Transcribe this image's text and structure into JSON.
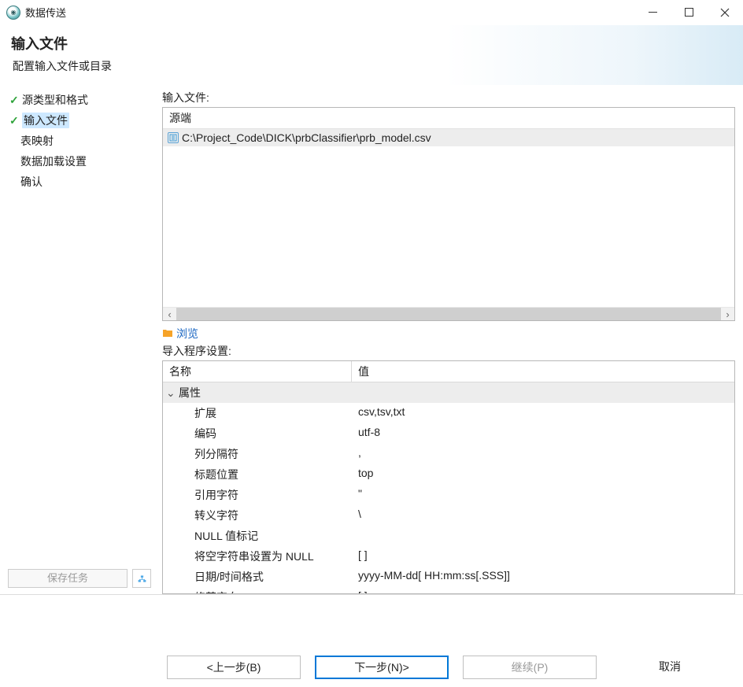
{
  "window": {
    "title": "数据传送"
  },
  "header": {
    "title": "输入文件",
    "subtitle": "配置输入文件或目录"
  },
  "sidebar": {
    "steps": [
      {
        "label": "源类型和格式",
        "checked": true,
        "current": false
      },
      {
        "label": "输入文件",
        "checked": true,
        "current": true
      },
      {
        "label": "表映射",
        "checked": false,
        "current": false
      },
      {
        "label": "数据加载设置",
        "checked": false,
        "current": false
      },
      {
        "label": "确认",
        "checked": false,
        "current": false
      }
    ],
    "save_task_label": "保存任务"
  },
  "content": {
    "input_files_label": "输入文件:",
    "filelist_header": "源端",
    "file_path": "C:\\Project_Code\\DICK\\prbClassifier\\prb_model.csv",
    "browse_label": "浏览",
    "importer_settings_label": "导入程序设置:",
    "table_name_header": "名称",
    "table_value_header": "值",
    "group_label": "属性",
    "properties": [
      {
        "name": "扩展",
        "value": "csv,tsv,txt"
      },
      {
        "name": "编码",
        "value": "utf-8"
      },
      {
        "name": "列分隔符",
        "value": ","
      },
      {
        "name": "标题位置",
        "value": "top"
      },
      {
        "name": "引用字符",
        "value": "\""
      },
      {
        "name": "转义字符",
        "value": "\\"
      },
      {
        "name": "NULL 值标记",
        "value": ""
      },
      {
        "name": "将空字符串设置为 NULL",
        "value": "[ ]"
      },
      {
        "name": "日期/时间格式",
        "value": "yyyy-MM-dd[ HH:mm:ss[.SSS]]"
      },
      {
        "name": "修剪空白",
        "value": "[ ]"
      }
    ]
  },
  "footer": {
    "back": "<上一步(B)",
    "next": "下一步(N)>",
    "continue": "继续(P)",
    "cancel": "取消"
  }
}
